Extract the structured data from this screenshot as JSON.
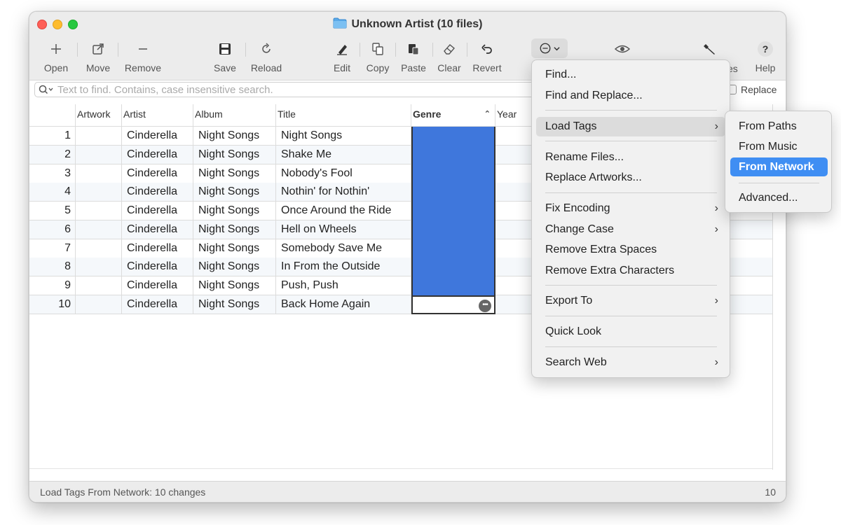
{
  "window": {
    "title": "Unknown Artist (10 files)"
  },
  "toolbar": {
    "open": "Open",
    "move": "Move",
    "remove": "Remove",
    "save": "Save",
    "reload": "Reload",
    "edit": "Edit",
    "copy": "Copy",
    "paste": "Paste",
    "clear": "Clear",
    "revert": "Revert",
    "files_partial": "es",
    "help": "Help"
  },
  "search": {
    "placeholder": "Text to find. Contains, case insensitive search.",
    "replace_label": "Replace"
  },
  "columns": {
    "artwork": "Artwork",
    "artist": "Artist",
    "album": "Album",
    "title": "Title",
    "genre": "Genre",
    "year": "Year"
  },
  "rows": [
    {
      "num": "1",
      "artist": "Cinderella",
      "album": "Night Songs",
      "title": "Night Songs"
    },
    {
      "num": "2",
      "artist": "Cinderella",
      "album": "Night Songs",
      "title": "Shake Me"
    },
    {
      "num": "3",
      "artist": "Cinderella",
      "album": "Night Songs",
      "title": "Nobody's Fool"
    },
    {
      "num": "4",
      "artist": "Cinderella",
      "album": "Night Songs",
      "title": "Nothin' for Nothin'"
    },
    {
      "num": "5",
      "artist": "Cinderella",
      "album": "Night Songs",
      "title": "Once Around the Ride"
    },
    {
      "num": "6",
      "artist": "Cinderella",
      "album": "Night Songs",
      "title": "Hell on Wheels"
    },
    {
      "num": "7",
      "artist": "Cinderella",
      "album": "Night Songs",
      "title": "Somebody Save Me"
    },
    {
      "num": "8",
      "artist": "Cinderella",
      "album": "Night Songs",
      "title": "In From the Outside"
    },
    {
      "num": "9",
      "artist": "Cinderella",
      "album": "Night Songs",
      "title": "Push, Push"
    },
    {
      "num": "10",
      "artist": "Cinderella",
      "album": "Night Songs",
      "title": "Back Home Again"
    }
  ],
  "menu": {
    "find": "Find...",
    "find_replace": "Find and Replace...",
    "load_tags": "Load Tags",
    "rename_files": "Rename Files...",
    "replace_artworks": "Replace Artworks...",
    "fix_encoding": "Fix Encoding",
    "change_case": "Change Case",
    "remove_spaces": "Remove Extra Spaces",
    "remove_chars": "Remove Extra Characters",
    "export_to": "Export To",
    "quick_look": "Quick Look",
    "search_web": "Search Web"
  },
  "submenu": {
    "from_paths": "From Paths",
    "from_music": "From Music",
    "from_network": "From Network",
    "advanced": "Advanced..."
  },
  "status": {
    "message": "Load Tags From Network: 10 changes",
    "count": "10"
  },
  "colors": {
    "selection": "#3f77dc",
    "menu_highlight": "#3f8ef3"
  }
}
